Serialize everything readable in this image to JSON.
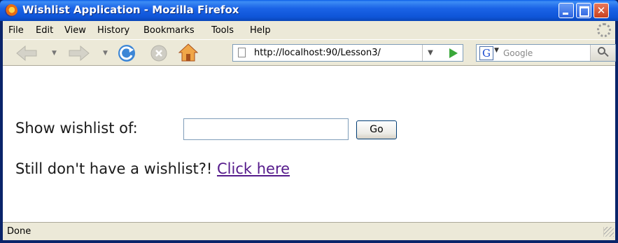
{
  "window": {
    "title": "Wishlist Application - Mozilla Firefox"
  },
  "menu": [
    "File",
    "Edit",
    "View",
    "History",
    "Bookmarks",
    "Tools",
    "Help"
  ],
  "navigation": {
    "url": "http://localhost:90/Lesson3/",
    "search_placeholder": "Google",
    "search_engine_glyph": "G"
  },
  "page": {
    "show_label": "Show wishlist of:",
    "name_input_value": "",
    "go_button": "Go",
    "no_wishlist_text": "Still don't have a wishlist?!",
    "click_here_link": "Click here"
  },
  "status": {
    "text": "Done"
  },
  "colors": {
    "titlebar": "#0a5ee8",
    "chrome": "#ece9d8",
    "visited_link": "#551a8b"
  }
}
